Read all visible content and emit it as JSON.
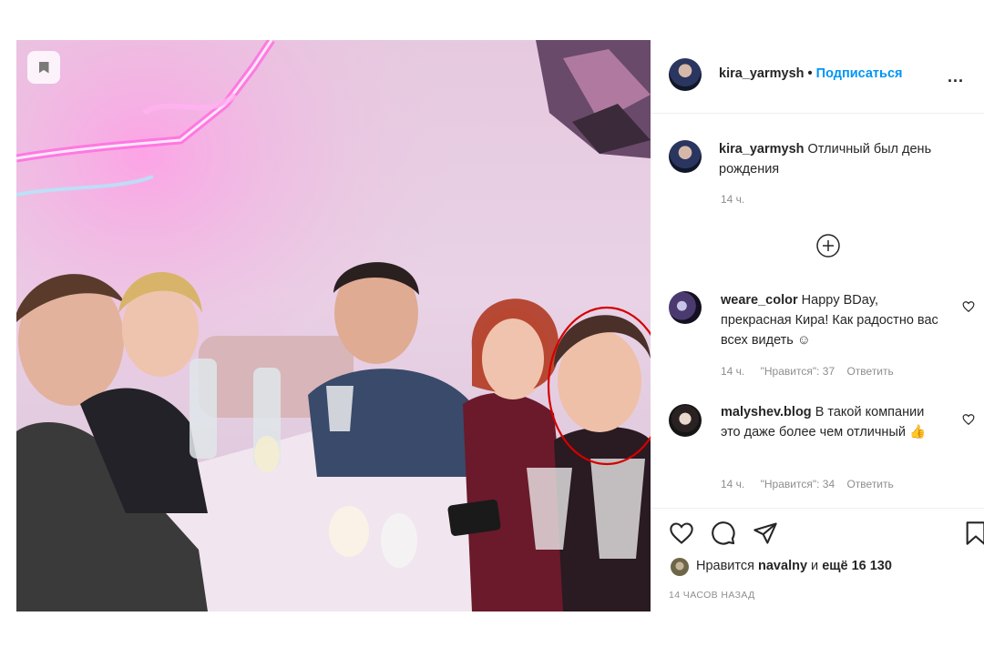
{
  "post": {
    "author": "kira_yarmysh",
    "separator": "•",
    "follow_label": "Подписаться",
    "more_label": "...",
    "caption": {
      "user": "kira_yarmysh",
      "text": "Отличный был день рождения",
      "time": "14 ч."
    }
  },
  "comments": [
    {
      "user": "weare_color",
      "text": "Happy BDay, прекрасная Кира! Как радостно вас всех видеть ☺",
      "time": "14 ч.",
      "likes": "\"Нравится\": 37",
      "reply": "Ответить"
    },
    {
      "user": "malyshev.blog",
      "text": "В такой компании это даже более чем отличный 👍",
      "time": "14 ч.",
      "likes": "\"Нравится\": 34",
      "reply": "Ответить"
    }
  ],
  "likes": {
    "prefix": "Нравится",
    "user": "navalny",
    "middle": "и",
    "rest": "ещё 16 130"
  },
  "timestamp": "14 ЧАСОВ НАЗАД",
  "colors": {
    "link": "#0095f6",
    "text": "#262626",
    "muted": "#8e8e8e",
    "highlight_circle": "#d40000"
  },
  "icons": [
    "bookmark-icon",
    "plus-circle-icon",
    "heart-icon",
    "comment-icon",
    "share-icon",
    "save-icon"
  ]
}
